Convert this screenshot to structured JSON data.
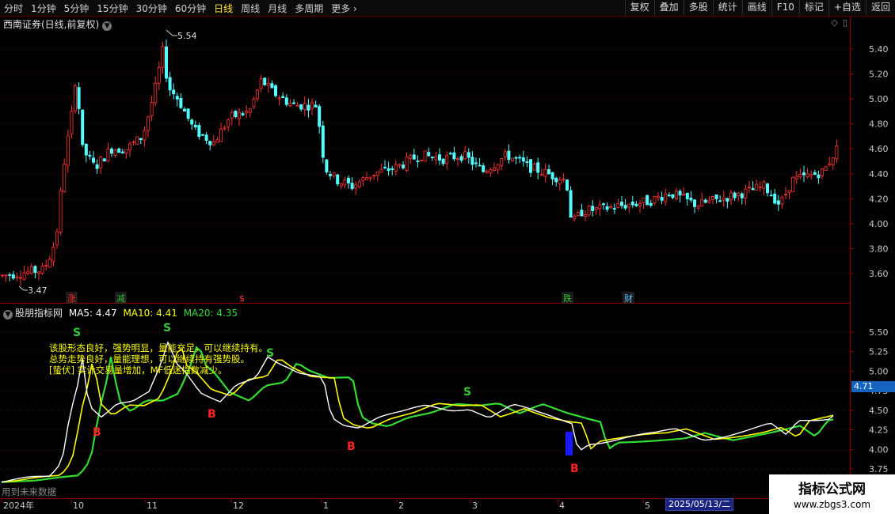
{
  "toolbar": {
    "periods": [
      "分时",
      "1分钟",
      "5分钟",
      "15分钟",
      "30分钟",
      "60分钟",
      "日线",
      "周线",
      "月线",
      "多周期",
      "更多"
    ],
    "active_period": "日线",
    "more_icon": "chevron-right-icon",
    "buttons": [
      "复权",
      "叠加",
      "多股",
      "统计",
      "画线",
      "F10",
      "标记",
      "+自选",
      "返回"
    ]
  },
  "stock": {
    "title": "西南证券(日线,前复权)"
  },
  "price_axis": {
    "ticks": [
      "5.40",
      "5.20",
      "5.00",
      "4.80",
      "4.60",
      "4.40",
      "4.20",
      "4.00",
      "3.80",
      "3.60"
    ]
  },
  "annotations": {
    "high": "5.54",
    "low": "3.47"
  },
  "event_markers": [
    {
      "label": "涨",
      "color": "#ff3333"
    },
    {
      "label": "减",
      "color": "#33cc33"
    },
    {
      "label": "$",
      "color": "#ff3333"
    },
    {
      "label": "跌",
      "color": "#33cc33"
    },
    {
      "label": "财",
      "color": "#66ccff"
    }
  ],
  "indicator": {
    "name": "股朋指标网",
    "ma5_label": "MA5: 4.47",
    "ma10_label": "MA10: 4.41",
    "ma20_label": "MA20: 4.35",
    "ma5_color": "#ffffff",
    "ma10_color": "#ffff00",
    "ma20_color": "#33dd33",
    "messages": [
      "该股形态良好，强势明显，量能充足，可以继续持有。",
      "总势走势良好，量能理想，可以继续持有强势股。",
      "[蛰伏] 实计交易量增加，MF低迷指数减少。"
    ],
    "axis_ticks": [
      "5.50",
      "5.25",
      "5.00",
      "4.75",
      "4.50",
      "4.25",
      "4.00",
      "3.75"
    ],
    "current_value": "4.71",
    "signals": [
      {
        "label": "S",
        "color": "#33cc33"
      },
      {
        "label": "S",
        "color": "#33cc33"
      },
      {
        "label": "S",
        "color": "#33cc33"
      },
      {
        "label": "S",
        "color": "#33cc33"
      },
      {
        "label": "B",
        "color": "#ff2222"
      },
      {
        "label": "B",
        "color": "#ff2222"
      },
      {
        "label": "B",
        "color": "#ff2222"
      },
      {
        "label": "B",
        "color": "#ff2222"
      }
    ]
  },
  "bottom_note": "用到未来数据",
  "time_axis": [
    "2024年",
    "10",
    "11",
    "12",
    "1",
    "2",
    "3",
    "4",
    "5"
  ],
  "cursor_date": "2025/05/13/二",
  "watermark": {
    "title": "指标公式网",
    "url": "www.zbgs3.com"
  },
  "colors": {
    "up": "#ff3333",
    "down": "#54ffff",
    "grid": "#5a0000",
    "accent": "#ffeb3b"
  }
}
